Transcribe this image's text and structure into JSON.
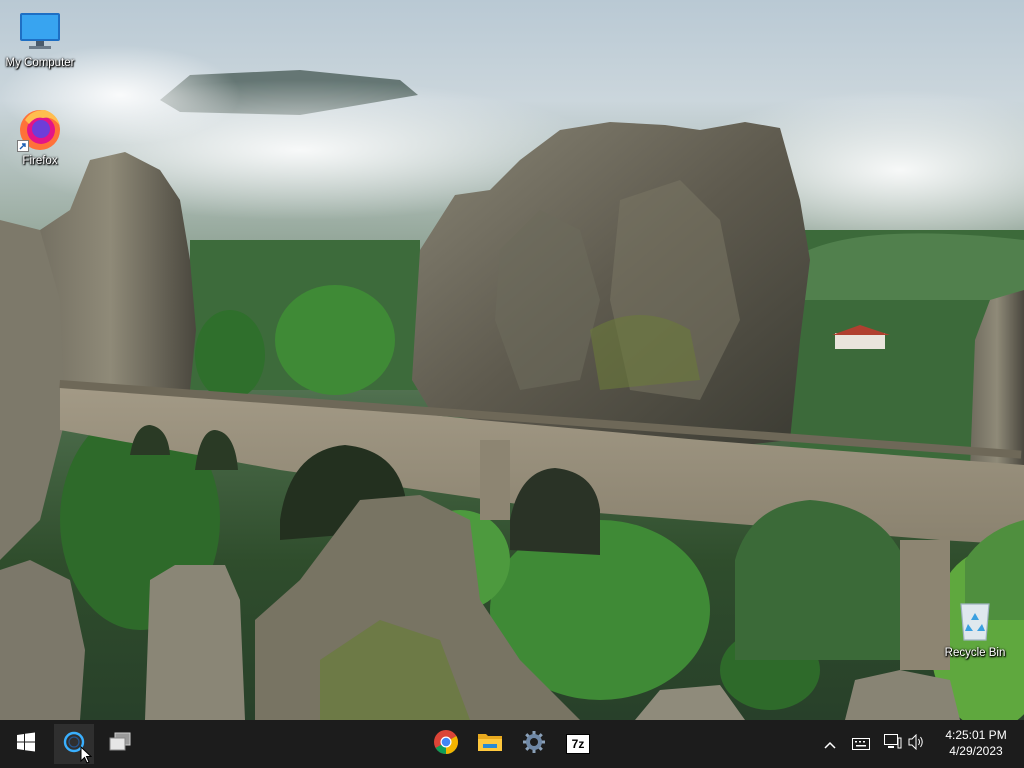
{
  "desktop": {
    "icons": [
      {
        "label": "My Computer",
        "icon": "monitor-icon"
      },
      {
        "label": "Firefox",
        "icon": "firefox-icon"
      },
      {
        "label": "Recycle Bin",
        "icon": "recycle-bin-icon"
      }
    ]
  },
  "taskbar": {
    "start": {
      "icon": "windows-start-icon"
    },
    "search": {
      "icon": "search-circle-icon",
      "active": true
    },
    "task_view": {
      "icon": "task-view-icon"
    },
    "pinned": [
      {
        "icon": "chrome-icon"
      },
      {
        "icon": "file-explorer-icon"
      },
      {
        "icon": "settings-gear-icon"
      },
      {
        "icon": "7zip-icon",
        "text": "7z"
      }
    ],
    "tray": {
      "icons": [
        "chevron-up-icon",
        "keyboard-icon",
        "network-icon",
        "volume-icon"
      ],
      "time": "4:25:01 PM",
      "date": "4/29/2023"
    }
  },
  "colors": {
    "taskbar_bg": "#1c1c1c",
    "accent_blue": "#0078d4"
  }
}
